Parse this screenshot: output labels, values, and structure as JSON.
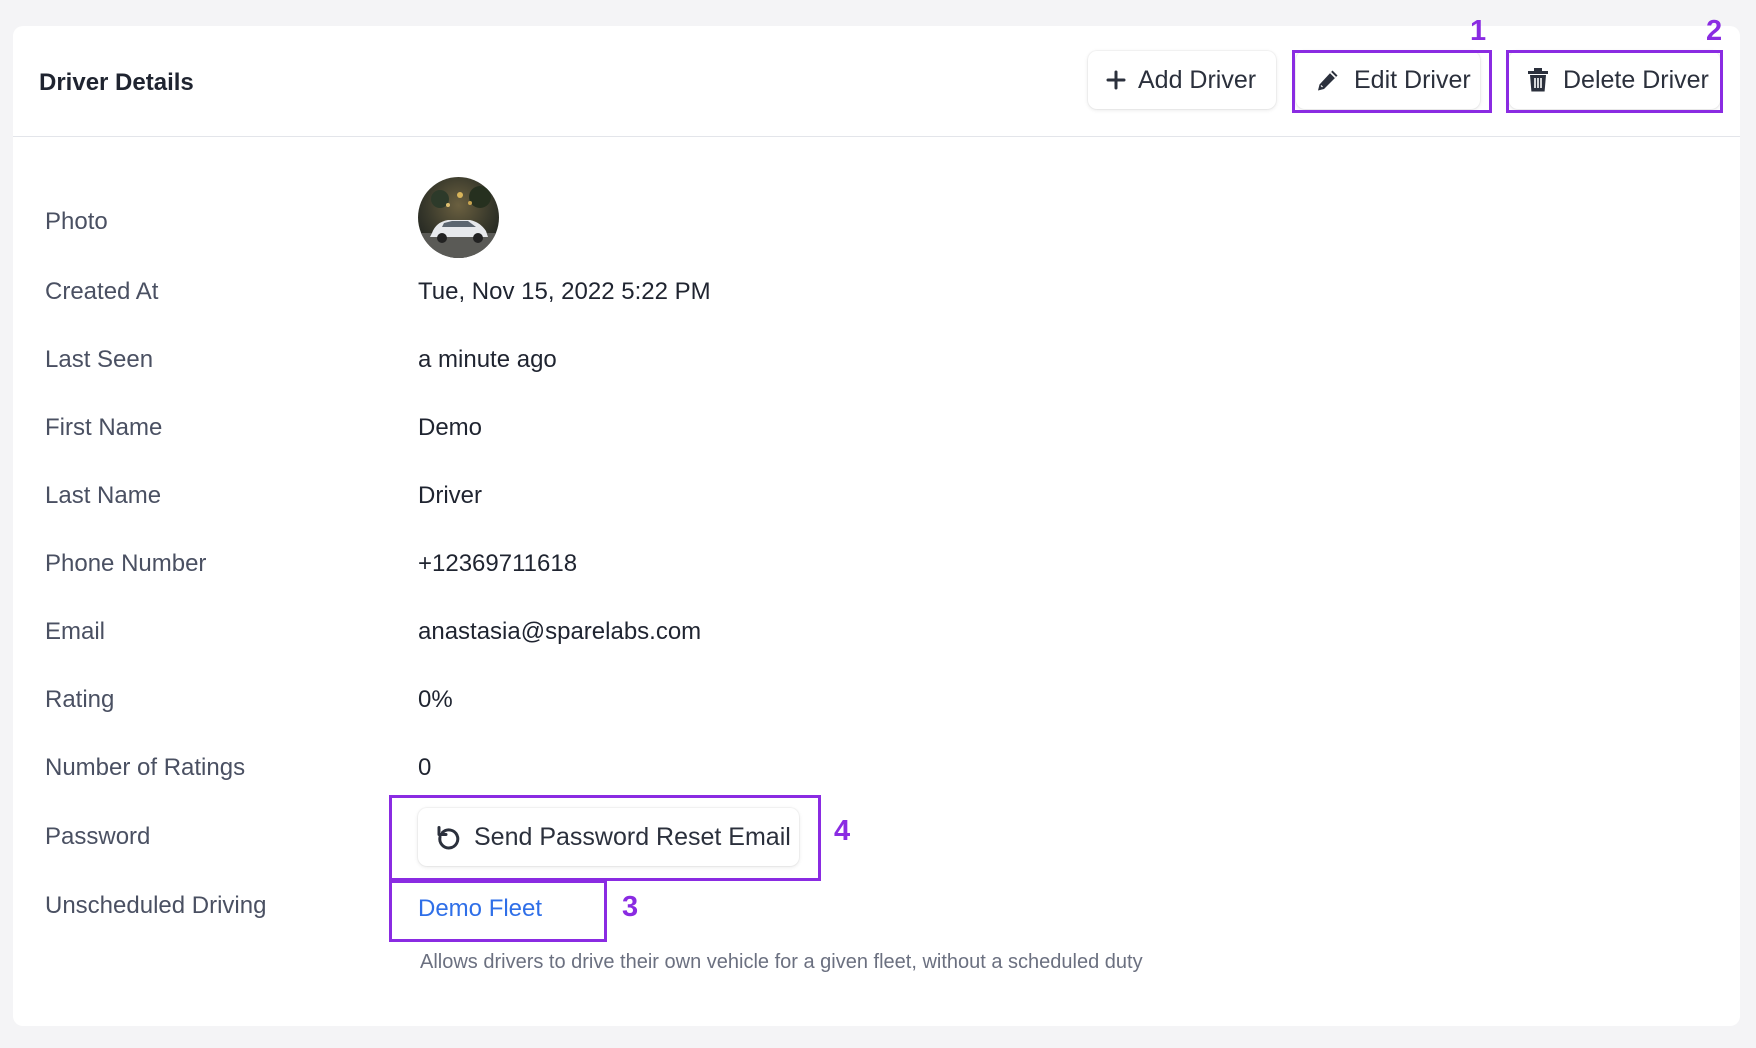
{
  "header": {
    "title": "Driver Details",
    "add_driver_label": "Add Driver",
    "edit_driver_label": "Edit Driver",
    "delete_driver_label": "Delete Driver"
  },
  "details": {
    "photo_label": "Photo",
    "created_at_label": "Created At",
    "created_at_value": "Tue, Nov 15, 2022 5:22 PM",
    "last_seen_label": "Last Seen",
    "last_seen_value": "a minute ago",
    "first_name_label": "First Name",
    "first_name_value": "Demo",
    "last_name_label": "Last Name",
    "last_name_value": "Driver",
    "phone_label": "Phone Number",
    "phone_value": "+12369711618",
    "email_label": "Email",
    "email_value": "anastasia@sparelabs.com",
    "rating_label": "Rating",
    "rating_value": "0%",
    "num_ratings_label": "Number of Ratings",
    "num_ratings_value": "0",
    "password_label": "Password",
    "reset_button_label": "Send Password Reset Email",
    "unscheduled_label": "Unscheduled Driving",
    "unscheduled_link": "Demo Fleet",
    "unscheduled_helper": "Allows drivers to drive their own vehicle for a given fleet, without a scheduled duty"
  },
  "annotations": {
    "edit": "1",
    "delete": "2",
    "fleet_link": "3",
    "reset_button": "4"
  },
  "colors": {
    "annotation": "#8a2be2",
    "link": "#2f6fe8",
    "background": "#f4f4f6"
  },
  "icons": {
    "add": "plus-icon",
    "edit": "pencil-icon",
    "delete": "trash-icon",
    "reset": "undo-icon"
  }
}
